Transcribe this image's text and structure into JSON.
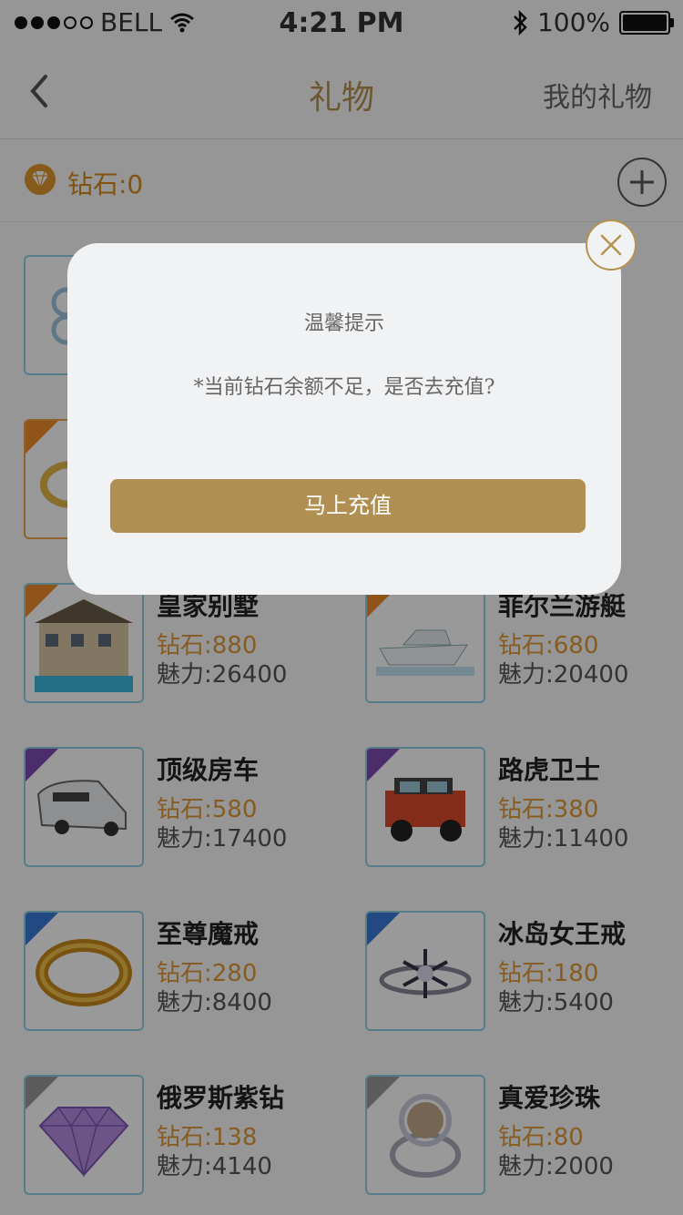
{
  "status": {
    "carrier": "BELL",
    "time": "4:21 PM",
    "battery": "100%"
  },
  "nav": {
    "title": "礼物",
    "right": "我的礼物"
  },
  "diamond": {
    "label": "钻石:0"
  },
  "gifts": [
    {
      "name": "皇家别墅",
      "price": "钻石:880",
      "charm": "魅力:26400"
    },
    {
      "name": "菲尔兰游艇",
      "price": "钻石:680",
      "charm": "魅力:20400"
    },
    {
      "name": "顶级房车",
      "price": "钻石:580",
      "charm": "魅力:17400"
    },
    {
      "name": "路虎卫士",
      "price": "钻石:380",
      "charm": "魅力:11400"
    },
    {
      "name": "至尊魔戒",
      "price": "钻石:280",
      "charm": "魅力:8400"
    },
    {
      "name": "冰岛女王戒",
      "price": "钻石:180",
      "charm": "魅力:5400"
    },
    {
      "name": "俄罗斯紫钻",
      "price": "钻石:138",
      "charm": "魅力:4140"
    },
    {
      "name": "真爱珍珠",
      "price": "钻石:80",
      "charm": "魅力:2000"
    }
  ],
  "modal": {
    "title": "温馨提示",
    "message": "*当前钻石余额不足，是否去充值?",
    "button": "马上充值"
  },
  "colors": {
    "accent": "#b6924f",
    "price": "#e09a39",
    "button": "#b09052"
  }
}
